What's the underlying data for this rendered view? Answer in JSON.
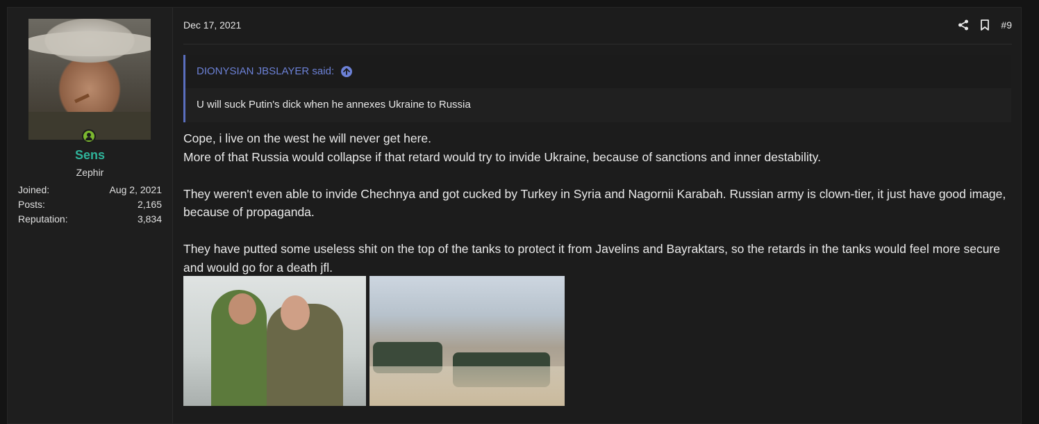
{
  "user": {
    "name": "Sens",
    "title": "Zephir",
    "stats": [
      {
        "label": "Joined:",
        "value": "Aug 2, 2021"
      },
      {
        "label": "Posts:",
        "value": "2,165"
      },
      {
        "label": "Reputation:",
        "value": "3,834"
      }
    ]
  },
  "post": {
    "date": "Dec 17, 2021",
    "number": "#9",
    "icons": [
      "share-icon",
      "bookmark-icon"
    ]
  },
  "quote": {
    "author": "DIONYSIAN JBSLAYER said:",
    "text": "U will suck Putin's dick when he annexes Ukraine to Russia"
  },
  "message": {
    "lines": [
      "Cope, i live on the west he will never get here.",
      "More of that Russia would collapse if that retard would try to invide Ukraine, because of sanctions and inner destability.",
      "They weren't even able to invide Chechnya and got cucked by Turkey in Syria and Nagornii Karabah. Russian army is clown-tier, it just have good image, because of propaganda.",
      "They have putted some useless shit on the top of the tanks to protect it from Javelins and Bayraktars, so the retards in the tanks would feel more secure and would go for a death jfl."
    ]
  },
  "colors": {
    "username": "#2fb39a",
    "quote_accent": "#6c81d6",
    "online": "#7cb82f"
  }
}
